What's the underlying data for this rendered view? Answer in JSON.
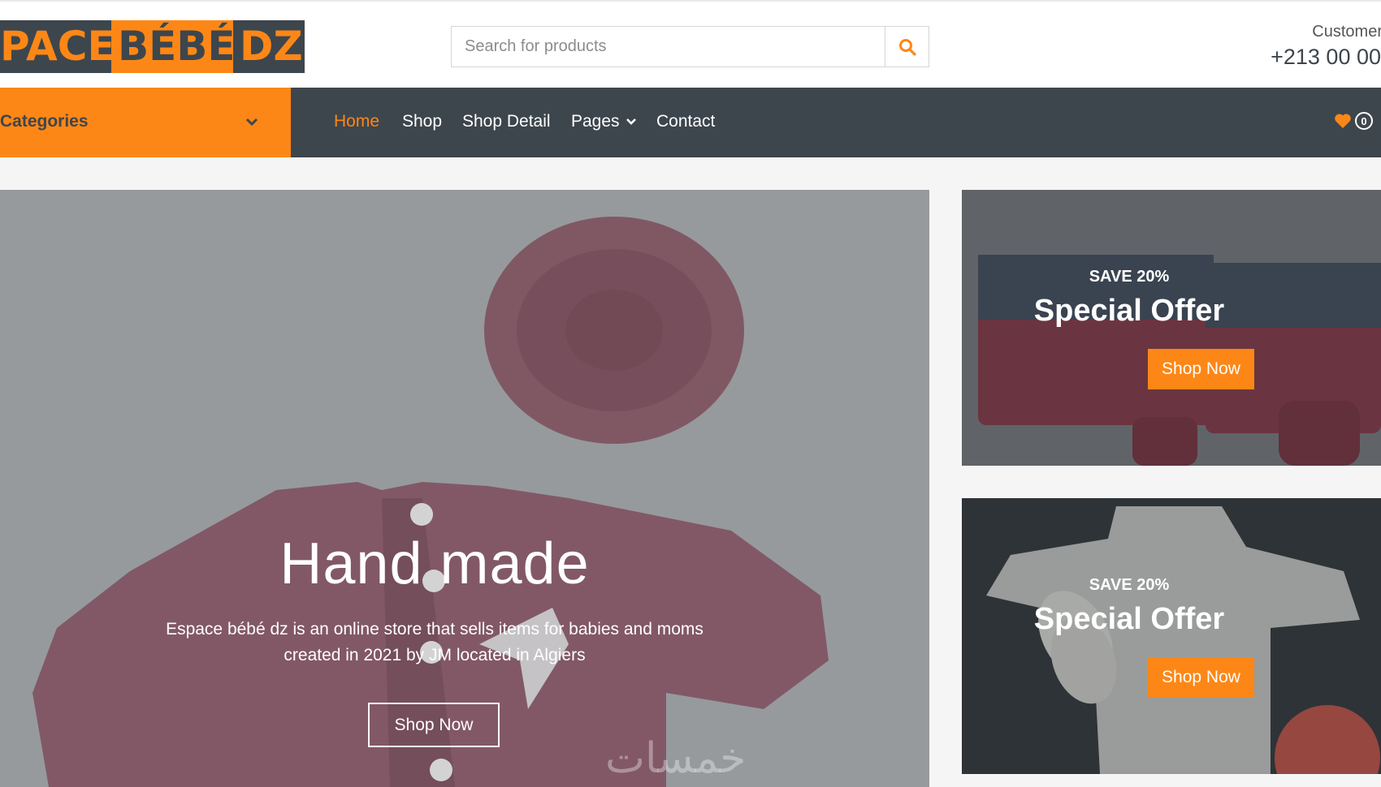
{
  "brand": {
    "logo_part1": "PACE",
    "logo_part2": "BÉBÉ",
    "logo_part3": "DZ",
    "primary_color": "#fd8716",
    "dark_color": "#3d464d"
  },
  "search": {
    "placeholder": "Search for products",
    "button_icon": "search-icon"
  },
  "customer": {
    "label": "Customer",
    "phone": "+213 00 00"
  },
  "nav": {
    "categories_label": "Categories",
    "items": [
      {
        "label": "Home",
        "active": true
      },
      {
        "label": "Shop",
        "active": false
      },
      {
        "label": "Shop Detail",
        "active": false
      },
      {
        "label": "Pages",
        "active": false
      },
      {
        "label": "Contact",
        "active": false
      }
    ],
    "wishlist_count": "0"
  },
  "hero": {
    "title": "Hand made",
    "description": "Espace bébé dz is an online store that sells items for babies and moms created in 2021 by JM located in Algiers",
    "button": "Shop Now"
  },
  "offers": [
    {
      "save": "SAVE 20%",
      "title": "Special Offer",
      "button": "Shop Now"
    },
    {
      "save": "SAVE 20%",
      "title": "Special Offer",
      "button": "Shop Now"
    }
  ],
  "watermark": "خمسات"
}
